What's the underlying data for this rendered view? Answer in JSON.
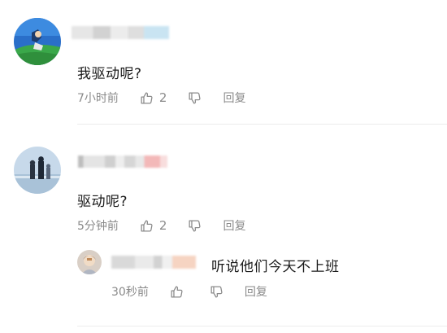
{
  "comments": [
    {
      "text": "我驱动呢?",
      "time": "7小时前",
      "like_count": "2",
      "reply_label": "回复"
    },
    {
      "text": "驱动呢?",
      "time": "5分钟前",
      "like_count": "2",
      "reply_label": "回复",
      "replies": [
        {
          "text": "听说他们今天不上班",
          "time": "30秒前",
          "reply_label": "回复"
        }
      ]
    }
  ],
  "icons": {
    "like": "thumbs-up-icon",
    "dislike": "thumbs-down-icon"
  }
}
